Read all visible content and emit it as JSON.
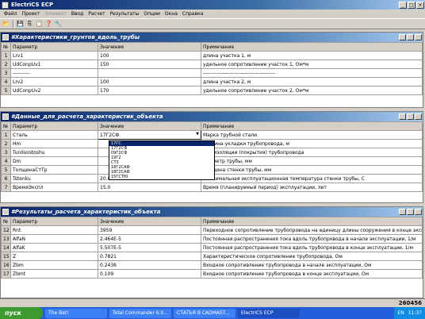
{
  "window": {
    "title": "ElectriCS ECP"
  },
  "menu": [
    {
      "label": "Файл",
      "disabled": false
    },
    {
      "label": "Проект",
      "disabled": false
    },
    {
      "label": "Элемент",
      "disabled": true
    },
    {
      "label": "Ввод",
      "disabled": false
    },
    {
      "label": "Расчет",
      "disabled": false
    },
    {
      "label": "Результаты",
      "disabled": false
    },
    {
      "label": "Опции",
      "disabled": false
    },
    {
      "label": "Окна",
      "disabled": false
    },
    {
      "label": "Справка",
      "disabled": false
    }
  ],
  "toolbar": {
    "icons": [
      "open-icon",
      "save-icon",
      "copy-icon",
      "paste-icon",
      "help-icon",
      "tool-icon"
    ]
  },
  "panel1": {
    "title": "#Характеристики_грунтов_вдоль_трубы",
    "headers": [
      "№",
      "Параметр",
      "Значение",
      "Примечание"
    ],
    "rows": [
      [
        "1",
        "Lrv1",
        "100",
        "длина участка 1, м"
      ],
      [
        "2",
        "UdConpUv1",
        "150",
        "удельное сопротивление участок 1, Ом*м"
      ],
      [
        "3",
        "----------",
        "",
        "------------------------------------------"
      ],
      [
        "4",
        "Lrv2",
        "100",
        "длина участка 2, м"
      ],
      [
        "5",
        "UdConpUv2",
        "170",
        "удельное сопротивление участок 2, Ом*м"
      ]
    ]
  },
  "panel2": {
    "title": "#Данные_для_расчета_характеристик_объекта",
    "headers": [
      "№",
      "Параметр",
      "Значение",
      "Примечание"
    ],
    "rows": [
      [
        "1",
        "Сталь",
        "17Г2СФ",
        "Марка трубной стали"
      ],
      [
        "2",
        "Hm",
        "",
        "глубина укладки трубопровода, м"
      ],
      [
        "3",
        "TunIIsostoshu",
        "",
        "Тип изоляции (покрытия) трубопровода"
      ],
      [
        "4",
        "Dm",
        "",
        "Диаметр трубы, мм"
      ],
      [
        "5",
        "ТолщинаСтТр",
        "",
        "Толщина стенки трубы, мм"
      ],
      [
        "6",
        "Tstenku",
        "20.0",
        "Максимальная эксплуатационная температура стенки трубы, С"
      ],
      [
        "7",
        "ВремяЭкспл",
        "15.0",
        "Время (планируемый период) эксплуатации, лет"
      ]
    ],
    "dropdown_options": [
      "17ГС",
      "17Г2СФ",
      "09Г2СФ",
      "19Г2",
      "СТ3",
      "18Г2САФ",
      "18Г2САФ",
      "15ГСТЮ"
    ],
    "dropdown_selected": 0
  },
  "panel3": {
    "title": "#Результаты_расчета_характеристик_объекта",
    "headers": [
      "№",
      "Параметр",
      "Значение",
      "Примечание"
    ],
    "rows": [
      [
        "12",
        "Rnt",
        "3959",
        "Переходное сопротивление трубопровода на единицу длины сооружения в конце эксплуатации,"
      ],
      [
        "13",
        "AlfaN",
        "2.464E-5",
        "Постоянная распространения тока вдоль трубопровода в начале эксплуатации, 1/м"
      ],
      [
        "14",
        "AlfaK",
        "5.507E-5",
        "Постоянная распространения тока вдоль трубопровода в конце эксплуатации, 1/м"
      ],
      [
        "15",
        "Z",
        "0.7821",
        "Характеристическое сопротивление трубопровода, Ом"
      ],
      [
        "16",
        "Zbm",
        "0.2436",
        "Входное сопротивление трубопровода в начале эксплуатации, Ом"
      ],
      [
        "17",
        "Zbmt",
        "0.109",
        "Входное сопротивление трубопровода в конце эксплуатации, Ом"
      ]
    ]
  },
  "status": {
    "value": "260456"
  },
  "taskbar": {
    "start": "пуск",
    "tasks": [
      "The Bat!",
      "Total Commander 6.0...",
      "СТАТЬЯ В CADMAST...",
      "ElectriCS ECP"
    ],
    "active_task": 3,
    "lang": "EN",
    "time": "11:37"
  }
}
